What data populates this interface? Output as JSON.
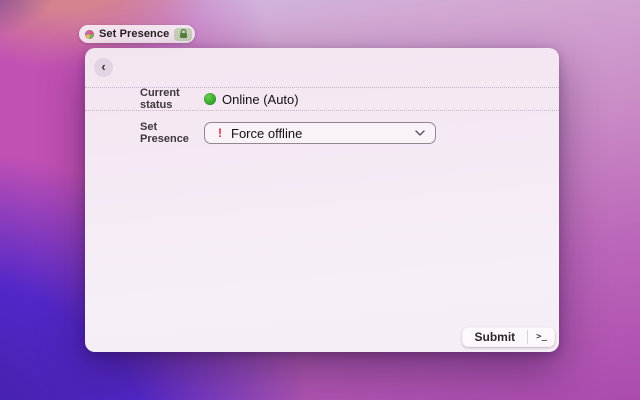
{
  "tab": {
    "title": "Set Presence"
  },
  "toolbar": {
    "back_glyph": "‹"
  },
  "form": {
    "current_status": {
      "label": "Current status",
      "value": "Online (Auto)"
    },
    "set_presence": {
      "label": "Set Presence",
      "selected_option": "Force offline",
      "warning_glyph": "!"
    }
  },
  "footer": {
    "submit_label": "Submit",
    "terminal_glyph": ">_"
  },
  "colors": {
    "status_online_green": "#36a930",
    "warning_red": "#d62b3a",
    "window_background": "#f4e9f3",
    "wallpaper_magenta": "#c251b4",
    "wallpaper_violet": "#5227c8"
  }
}
